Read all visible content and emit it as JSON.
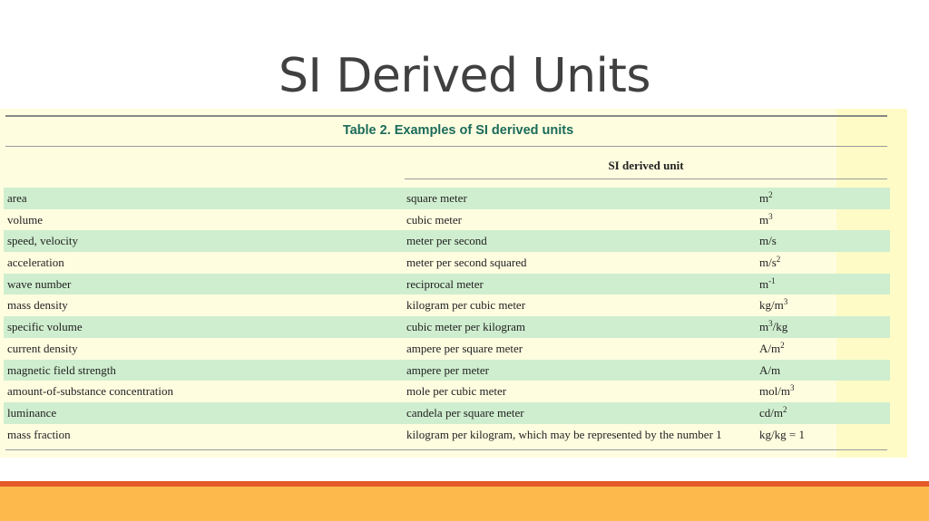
{
  "slide": {
    "title": "SI Derived Units"
  },
  "table": {
    "caption": "Table 2.  Examples of SI derived units",
    "column_header": "SI derived unit",
    "rows": [
      {
        "quantity": "area",
        "name": "square meter",
        "sym_base": "m",
        "sym_sup": "2",
        "sym_tail": ""
      },
      {
        "quantity": "volume",
        "name": "cubic meter",
        "sym_base": "m",
        "sym_sup": "3",
        "sym_tail": ""
      },
      {
        "quantity": "speed, velocity",
        "name": "meter per second",
        "sym_base": "m/s",
        "sym_sup": "",
        "sym_tail": ""
      },
      {
        "quantity": "acceleration",
        "name": "meter per second squared",
        "sym_base": "m/s",
        "sym_sup": "2",
        "sym_tail": ""
      },
      {
        "quantity": "wave number",
        "name": "reciprocal meter",
        "sym_base": "m",
        "sym_sup": "-1",
        "sym_tail": ""
      },
      {
        "quantity": "mass density",
        "name": "kilogram per cubic meter",
        "sym_base": "kg/m",
        "sym_sup": "3",
        "sym_tail": ""
      },
      {
        "quantity": "specific volume",
        "name": "cubic meter per kilogram",
        "sym_base": "m",
        "sym_sup": "3",
        "sym_tail": "/kg"
      },
      {
        "quantity": "current density",
        "name": "ampere per square meter",
        "sym_base": "A/m",
        "sym_sup": "2",
        "sym_tail": ""
      },
      {
        "quantity": "magnetic field strength",
        "name": "ampere per meter",
        "sym_base": "A/m",
        "sym_sup": "",
        "sym_tail": ""
      },
      {
        "quantity": "amount-of-substance concentration",
        "name": "mole per cubic meter",
        "sym_base": "mol/m",
        "sym_sup": "3",
        "sym_tail": ""
      },
      {
        "quantity": "luminance",
        "name": "candela per square meter",
        "sym_base": "cd/m",
        "sym_sup": "2",
        "sym_tail": ""
      },
      {
        "quantity": "mass fraction",
        "name": "kilogram per kilogram, which may be represented by the number 1",
        "sym_base": "kg/kg = 1",
        "sym_sup": "",
        "sym_tail": ""
      }
    ]
  },
  "colors": {
    "row_shade": "#cfeecf",
    "caption": "#1a6b5a",
    "band_red": "#e45a28",
    "band_yellow": "#fdb94c"
  }
}
